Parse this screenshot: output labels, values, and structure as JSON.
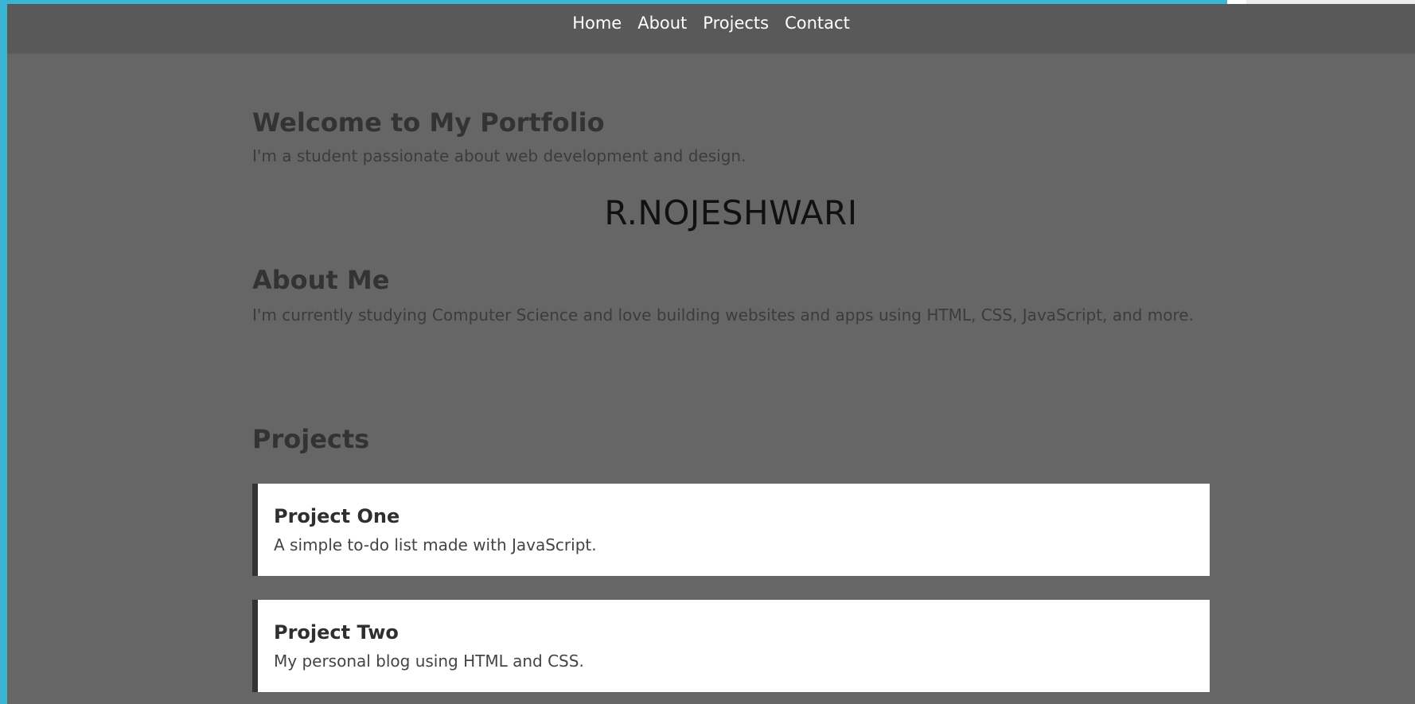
{
  "nav": {
    "items": [
      {
        "label": "Home"
      },
      {
        "label": "About"
      },
      {
        "label": "Projects"
      },
      {
        "label": "Contact"
      }
    ]
  },
  "hero": {
    "title": "Welcome to My Portfolio",
    "subtitle": "I'm a student passionate about web development and design.",
    "name": "R.NOJESHWARI"
  },
  "about": {
    "title": "About Me",
    "text": "I'm currently studying Computer Science and love building websites and apps using HTML, CSS, JavaScript, and more."
  },
  "projects": {
    "title": "Projects",
    "items": [
      {
        "title": "Project One",
        "description": "A simple to-do list made with JavaScript."
      },
      {
        "title": "Project Two",
        "description": "My personal blog using HTML and CSS."
      }
    ]
  },
  "colors": {
    "page_background": "#666666",
    "navbar_background": "#595959",
    "outer_accent": "#39b6d3",
    "card_background": "#ffffff",
    "card_border": "#333333"
  }
}
